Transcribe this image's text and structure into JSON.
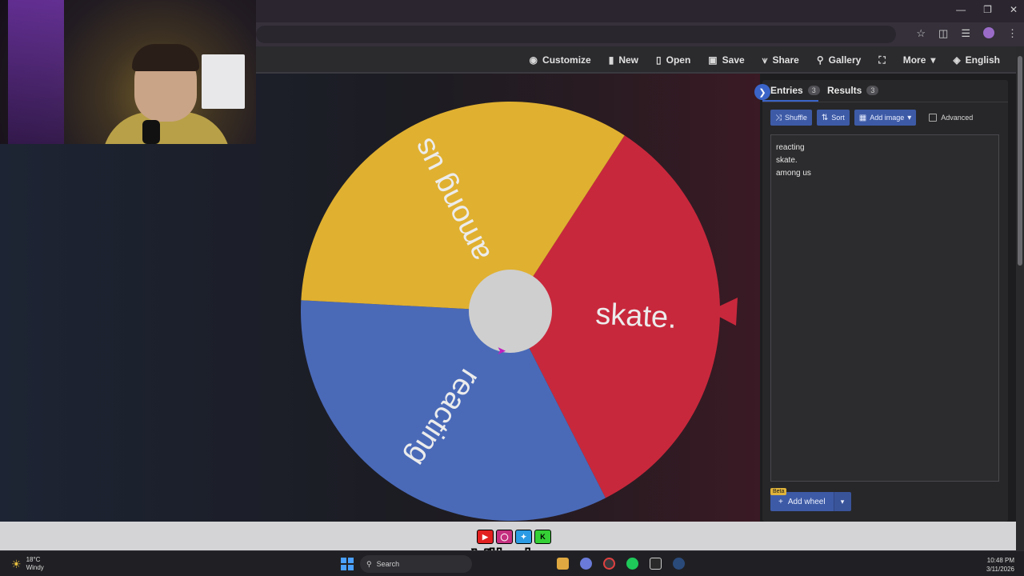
{
  "toolbar": {
    "items": [
      {
        "label": "Customize",
        "icon": "palette-icon"
      },
      {
        "label": "New",
        "icon": "file-icon"
      },
      {
        "label": "Open",
        "icon": "folder-icon"
      },
      {
        "label": "Save",
        "icon": "save-icon"
      },
      {
        "label": "Share",
        "icon": "share-icon"
      },
      {
        "label": "Gallery",
        "icon": "search-icon"
      },
      {
        "label": "",
        "icon": "fullscreen-icon"
      },
      {
        "label": "More",
        "icon": "chevron-down-icon"
      },
      {
        "label": "English",
        "icon": "globe-icon"
      }
    ]
  },
  "wheel": {
    "segments": [
      {
        "label": "skate.",
        "color": "#c8283c"
      },
      {
        "label": "reacting",
        "color": "#4a6ab8"
      },
      {
        "label": "among us",
        "color": "#e0b030"
      }
    ],
    "hub_color": "#cfcfcf",
    "pointer_color": "#c8283c"
  },
  "panel": {
    "tabs": [
      {
        "label": "Entries",
        "count": "3"
      },
      {
        "label": "Results",
        "count": "3"
      }
    ],
    "buttons": {
      "shuffle": "Shuffle",
      "sort": "Sort",
      "add_image": "Add image",
      "advanced": "Advanced"
    },
    "entries": [
      "reacting",
      "skate.",
      "among us"
    ],
    "beta": "Beta",
    "add_wheel": "Add wheel"
  },
  "overlay": {
    "brand": "Vibzlo",
    "socials": [
      "youtube",
      "instagram",
      "twitter",
      "kick"
    ]
  },
  "taskbar": {
    "weather_temp": "18°C",
    "weather_desc": "Windy",
    "search_placeholder": "Search",
    "time": "10:48 PM",
    "date": "3/11/2026"
  }
}
